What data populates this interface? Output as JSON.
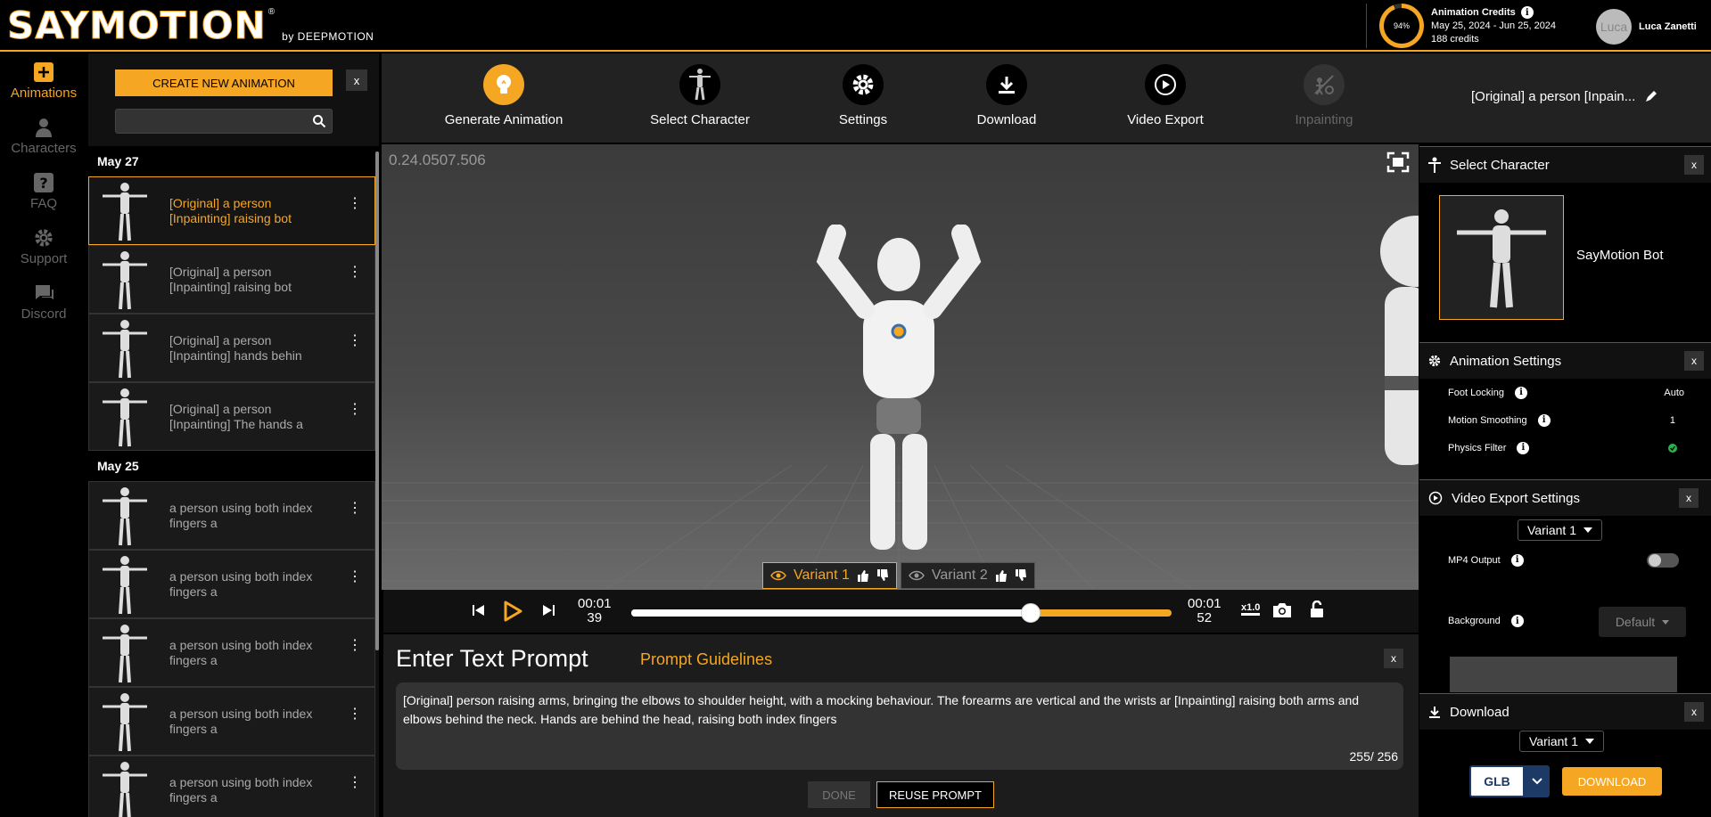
{
  "app": {
    "logo_text": "SAYMOTION",
    "logo_reg": "®",
    "logo_by": "by DEEPMOTION",
    "brand_color": "#f5a623"
  },
  "credits": {
    "title": "Animation Credits",
    "gauge_label": "94%",
    "gauge_fraction": 0.94,
    "date_range": "May 25, 2024 - Jun 25, 2024",
    "amount": "188 credits"
  },
  "user": {
    "avatar_text": "Luca",
    "name": "Luca Zanetti"
  },
  "nav": [
    {
      "label": "Animations",
      "icon": "plus-icon"
    },
    {
      "label": "Characters",
      "icon": "person-icon"
    },
    {
      "label": "FAQ",
      "icon": "question-icon"
    },
    {
      "label": "Support",
      "icon": "gear-icon"
    },
    {
      "label": "Discord",
      "icon": "chat-icon"
    }
  ],
  "list": {
    "create_label": "CREATE NEW ANIMATION",
    "close_label": "x",
    "search_placeholder": "",
    "groups": [
      {
        "date": "May 27",
        "items": [
          "[Original] a person [Inpainting] raising bot",
          "[Original] a person [Inpainting] raising bot",
          "[Original] a person [Inpainting] hands behin",
          "[Original] a person [Inpainting] The hands a"
        ]
      },
      {
        "date": "May 25",
        "items": [
          "a person using both index fingers a",
          "a person using both index fingers a",
          "a person using both index fingers a",
          "a person using both index fingers a",
          "a person using both index fingers a"
        ]
      }
    ]
  },
  "toolbar": {
    "tools": [
      "Generate Animation",
      "Select Character",
      "Settings",
      "Download",
      "Video Export",
      "Inpainting"
    ],
    "anim_title": "[Original] a person [Inpain..."
  },
  "viewport": {
    "version": "0.24.0507.506"
  },
  "variants": {
    "v1": "Variant 1",
    "v2": "Variant 2"
  },
  "player": {
    "current_time_top": "00:01",
    "current_time_bottom": "39",
    "total_time_top": "00:01",
    "total_time_bottom": "52",
    "progress": 0.74,
    "speed": "x1.0"
  },
  "prompt": {
    "title": "Enter Text Prompt",
    "guidelines": "Prompt Guidelines",
    "close_label": "x",
    "text": "[Original] person raising  arms, bringing the elbows to shoulder height, with a mocking behaviour. The forearms are vertical and the wrists ar [Inpainting] raising both arms and elbows behind the neck. Hands are behind the head, raising both index fingers",
    "count": "255/ 256",
    "done_label": "DONE",
    "reuse_label": "REUSE PROMPT"
  },
  "select_character": {
    "title": "Select Character",
    "close_label": "x",
    "character_name": "SayMotion Bot"
  },
  "animation_settings": {
    "title": "Animation Settings",
    "close_label": "x",
    "rows": [
      {
        "label": "Foot Locking",
        "value": "Auto"
      },
      {
        "label": "Motion Smoothing",
        "value": "1"
      },
      {
        "label": "Physics Filter",
        "value": ""
      }
    ]
  },
  "video_export": {
    "title": "Video Export Settings",
    "close_label": "x",
    "variant": "Variant 1",
    "mp4_label": "MP4 Output",
    "background_label": "Background",
    "background_value": "Default"
  },
  "download": {
    "title": "Download",
    "close_label": "x",
    "variant": "Variant 1",
    "format": "GLB",
    "button_label": "DOWNLOAD"
  }
}
